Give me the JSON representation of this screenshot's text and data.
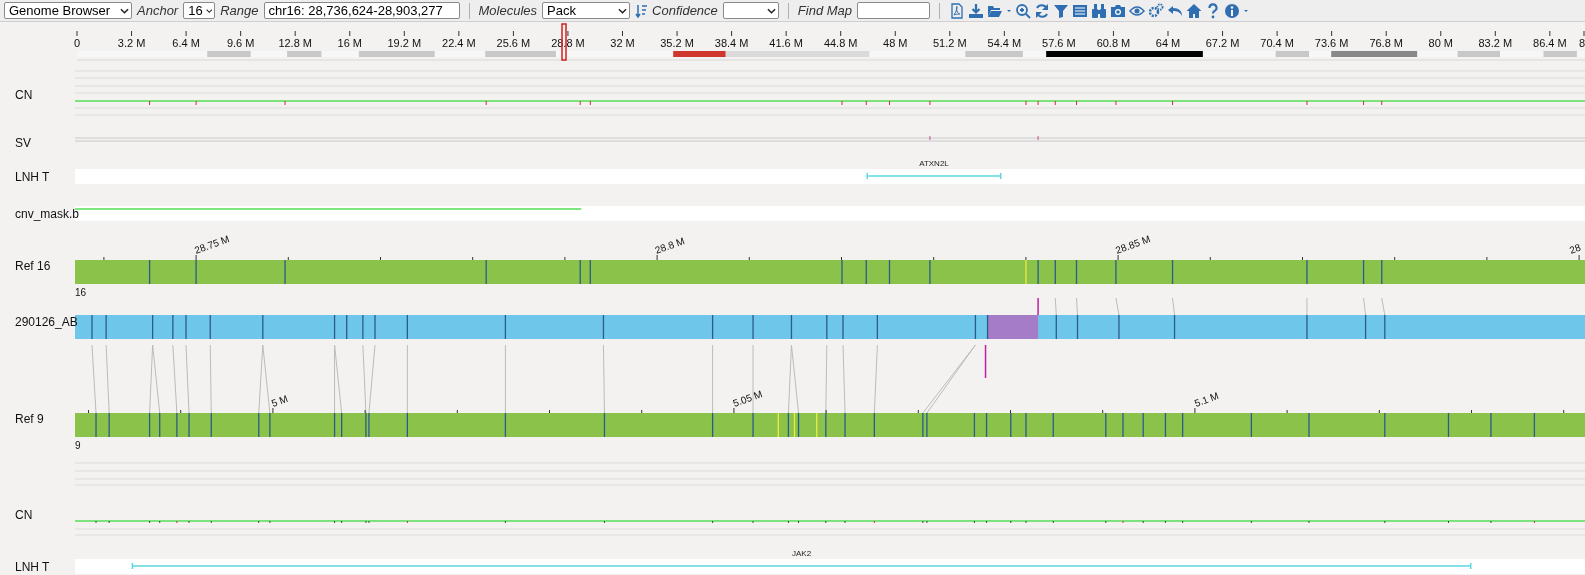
{
  "toolbar": {
    "view_select": "Genome Browser",
    "anchor_label": "Anchor",
    "anchor_select": "16",
    "range_label": "Range",
    "range_value": "chr16: 28,736,624-28,903,277",
    "molecules_label": "Molecules",
    "molecules_select": "Pack",
    "confidence_label": "Confidence",
    "find_map_label": "Find Map"
  },
  "chromosome_axis": {
    "ticks": [
      "0",
      "3.2 M",
      "6.4 M",
      "9.6 M",
      "12.8 M",
      "16 M",
      "19.2 M",
      "22.4 M",
      "25.6 M",
      "28.8 M",
      "32 M",
      "35.2 M",
      "38.4 M",
      "41.6 M",
      "44.8 M",
      "48 M",
      "51.2 M",
      "54.4 M",
      "57.6 M",
      "60.8 M",
      "64 M",
      "67.2 M",
      "70.4 M",
      "73.6 M",
      "76.8 M",
      "80 M",
      "83.2 M",
      "86.4 M",
      "8"
    ]
  },
  "tracks": [
    {
      "kind": "cn",
      "label": "CN"
    },
    {
      "kind": "sv",
      "label": "SV"
    },
    {
      "kind": "annotation",
      "label": "LNH T",
      "genes": [
        "ATXN2L"
      ]
    },
    {
      "kind": "mask",
      "label": "cnv_mask.b"
    },
    {
      "kind": "reference",
      "label": "Ref 16",
      "ticks": [
        "28.75 M",
        "28.8 M",
        "28.85 M",
        "28"
      ],
      "chromosome": "16"
    },
    {
      "kind": "molecule",
      "label": "290126_AB"
    },
    {
      "kind": "reference",
      "label": "Ref 9",
      "ticks": [
        "5 M",
        "5.05 M",
        "5.1 M"
      ],
      "chromosome": "9"
    },
    {
      "kind": "cn",
      "label": "CN"
    },
    {
      "kind": "annotation",
      "label": "LNH T",
      "genes": [
        "JAK2"
      ]
    }
  ]
}
